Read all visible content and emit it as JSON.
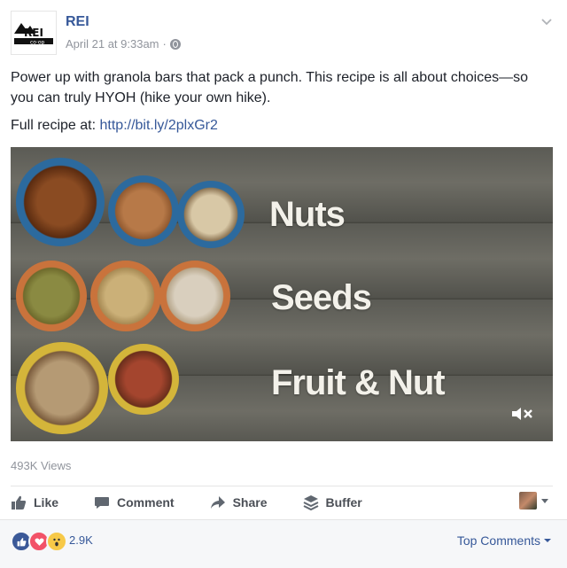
{
  "post": {
    "page_name": "REI",
    "logo_text": "REI",
    "logo_subtext": "co·op",
    "timestamp": "April 21 at 9:33am",
    "separator": "·",
    "privacy_icon": "globe-icon",
    "text": "Power up with granola bars that pack a punch. This recipe is all about choices—so you can truly HYOH (hike your own hike).",
    "recipe_prefix": "Full recipe at:",
    "recipe_link": "http://bit.ly/2plxGr2"
  },
  "video": {
    "labels": [
      "Nuts",
      "Seeds",
      "Fruit & Nut"
    ],
    "mute_icon": "speaker-muted-icon"
  },
  "stats": {
    "views": "493K Views"
  },
  "actions": {
    "like": "Like",
    "comment": "Comment",
    "share": "Share",
    "buffer": "Buffer"
  },
  "reactions": {
    "count": "2.9K",
    "top_comments": "Top Comments"
  },
  "colors": {
    "link": "#365899",
    "muted": "#90949c",
    "like_blue": "#3b5998",
    "love_red": "#f25268",
    "wow_yellow": "#f7c948"
  }
}
